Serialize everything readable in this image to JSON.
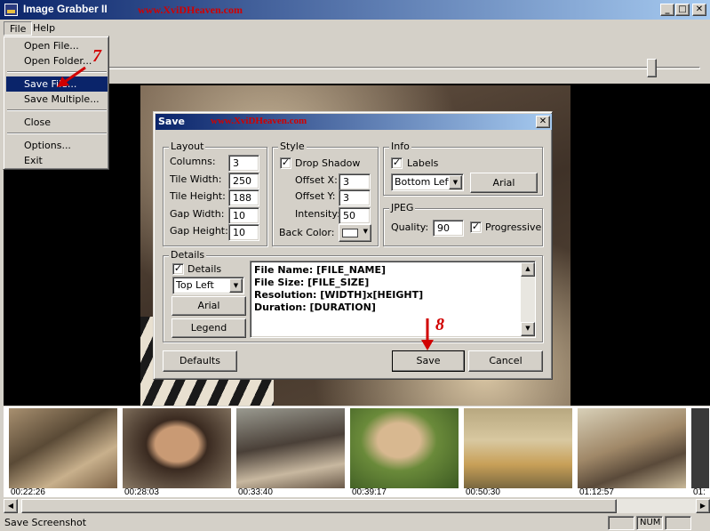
{
  "window": {
    "title": "Image Grabber II",
    "watermark": "www.XviDHeaven.com"
  },
  "menubar": {
    "file": "File",
    "help": "Help"
  },
  "file_menu": {
    "open_file": "Open File...",
    "open_folder": "Open Folder...",
    "save_file": "Save File...",
    "save_multiple": "Save Multiple...",
    "close": "Close",
    "options": "Options...",
    "exit": "Exit"
  },
  "annotations": {
    "step7": "7",
    "step8": "8"
  },
  "dialog": {
    "title": "Save",
    "watermark": "www.XviDHeaven.com",
    "layout": {
      "label": "Layout",
      "columns_label": "Columns:",
      "columns": "3",
      "tile_width_label": "Tile Width:",
      "tile_width": "250",
      "tile_height_label": "Tile Height:",
      "tile_height": "188",
      "gap_width_label": "Gap  Width:",
      "gap_width": "10",
      "gap_height_label": "Gap Height:",
      "gap_height": "10"
    },
    "style": {
      "label": "Style",
      "drop_shadow_label": "Drop Shadow",
      "drop_shadow_checked": true,
      "offset_x_label": "Offset X:",
      "offset_x": "3",
      "offset_y_label": "Offset Y:",
      "offset_y": "3",
      "intensity_label": "Intensity:",
      "intensity": "50",
      "back_color_label": "Back Color:"
    },
    "info": {
      "label": "Info",
      "labels_label": "Labels",
      "labels_checked": true,
      "position": "Bottom Left",
      "font_button": "Arial"
    },
    "jpeg": {
      "label": "JPEG",
      "quality_label": "Quality:",
      "quality": "90",
      "progressive_label": "Progressive",
      "progressive_checked": true
    },
    "details": {
      "label": "Details",
      "details_check_label": "Details",
      "details_checked": true,
      "position": "Top Left",
      "font_button": "Arial",
      "legend_button": "Legend",
      "lines": [
        "File Name: [FILE_NAME]",
        "File Size: [FILE_SIZE]",
        "Resolution: [WIDTH]x[HEIGHT]",
        "Duration: [DURATION]"
      ]
    },
    "buttons": {
      "defaults": "Defaults",
      "save": "Save",
      "cancel": "Cancel"
    }
  },
  "thumbnails": [
    "00:22:26",
    "00:28:03",
    "00:33:40",
    "00:39:17",
    "00:50:30",
    "01:12:57",
    "01:"
  ],
  "status": {
    "text": "Save Screenshot",
    "num": "NUM"
  },
  "colors": {
    "title_active": "#0a246a",
    "title_fade": "#a6caf0",
    "annotation": "#d10000",
    "face": "#d4d0c8"
  }
}
